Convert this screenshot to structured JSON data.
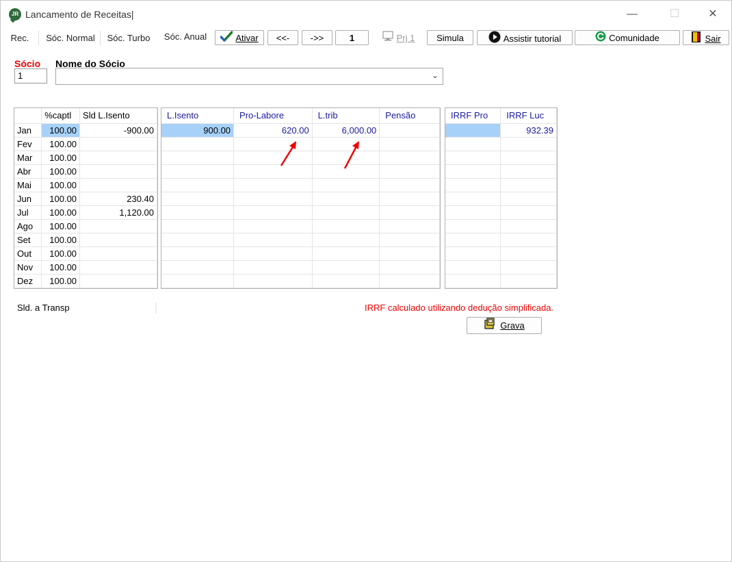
{
  "window": {
    "title": "Lancamento de Receitas|"
  },
  "toolbar": {
    "tabs": [
      "Rec.",
      "Sóc. Normal",
      "Sóc. Turbo",
      "Sóc. Anual"
    ],
    "ativar": "Ativar",
    "prev": "<<-",
    "next": "->>",
    "page": "1",
    "prj": "Prj 1",
    "simula": "Simula",
    "tutorial": "Assistir tutorial",
    "comunidade": "Comunidade",
    "sair": "Sair"
  },
  "socio": {
    "label": "Sócio",
    "value": "1",
    "nome_label": "Nome do Sócio",
    "nome_value": ""
  },
  "grid1": {
    "headers": [
      "",
      "%captl",
      "Sld L.Isento"
    ],
    "rows": [
      [
        "Jan",
        "100.00",
        "-900.00"
      ],
      [
        "Fev",
        "100.00",
        ""
      ],
      [
        "Mar",
        "100.00",
        ""
      ],
      [
        "Abr",
        "100.00",
        ""
      ],
      [
        "Mai",
        "100.00",
        ""
      ],
      [
        "Jun",
        "100.00",
        "230.40"
      ],
      [
        "Jul",
        "100.00",
        "1,120.00"
      ],
      [
        "Ago",
        "100.00",
        ""
      ],
      [
        "Set",
        "100.00",
        ""
      ],
      [
        "Out",
        "100.00",
        ""
      ],
      [
        "Nov",
        "100.00",
        ""
      ],
      [
        "Dez",
        "100.00",
        ""
      ]
    ]
  },
  "grid2": {
    "headers": [
      "L.Isento",
      "Pro-Labore",
      "L.trib",
      "Pensão"
    ],
    "rows": [
      [
        "900.00",
        "620.00",
        "6,000.00",
        ""
      ],
      [
        "",
        "",
        "",
        ""
      ],
      [
        "",
        "",
        "",
        ""
      ],
      [
        "",
        "",
        "",
        ""
      ],
      [
        "",
        "",
        "",
        ""
      ],
      [
        "",
        "",
        "",
        ""
      ],
      [
        "",
        "",
        "",
        ""
      ],
      [
        "",
        "",
        "",
        ""
      ],
      [
        "",
        "",
        "",
        ""
      ],
      [
        "",
        "",
        "",
        ""
      ],
      [
        "",
        "",
        "",
        ""
      ],
      [
        "",
        "",
        "",
        ""
      ]
    ]
  },
  "grid3": {
    "headers": [
      "IRRF Pro",
      "IRRF Luc"
    ],
    "rows": [
      [
        "",
        "932.39"
      ],
      [
        "",
        ""
      ],
      [
        "",
        ""
      ],
      [
        "",
        ""
      ],
      [
        "",
        ""
      ],
      [
        "",
        ""
      ],
      [
        "",
        ""
      ],
      [
        "",
        ""
      ],
      [
        "",
        ""
      ],
      [
        "",
        ""
      ],
      [
        "",
        ""
      ],
      [
        "",
        ""
      ]
    ]
  },
  "footer": {
    "sld_transp": "Sld. a Transp",
    "irrf_msg": "IRRF calculado utilizando dedução simplificada.",
    "grava": "Grava"
  },
  "colors": {
    "accent_red": "#e00000",
    "selection": "#a7d1f8",
    "value_blue": "#1a1aa0"
  }
}
